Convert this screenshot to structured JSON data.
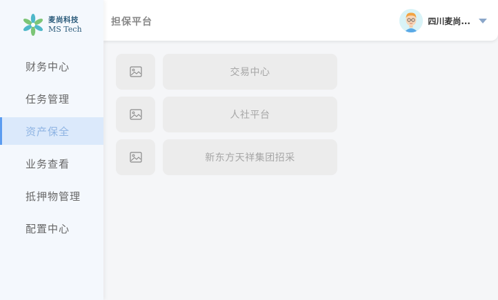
{
  "brand": {
    "name_cn": "麦尚科技",
    "name_en": "MS Tech"
  },
  "header": {
    "title": "担保平台",
    "user_name": "四川麦尚..."
  },
  "menu": {
    "items": [
      {
        "label": "财务中心",
        "active": false
      },
      {
        "label": "任务管理",
        "active": false
      },
      {
        "label": "资产保全",
        "active": true
      },
      {
        "label": "业务查看",
        "active": false
      },
      {
        "label": "抵押物管理",
        "active": false
      },
      {
        "label": "配置中心",
        "active": false
      }
    ]
  },
  "platforms": [
    {
      "label": "交易中心",
      "icon": "image-placeholder-icon"
    },
    {
      "label": "人社平台",
      "icon": "image-placeholder-icon"
    },
    {
      "label": "新东方天祥集团招采",
      "icon": "image-placeholder-icon"
    }
  ],
  "colors": {
    "accent": "#5b9cf0",
    "active_text": "#8fb4e3",
    "active_bg": "#dbe9fb",
    "tile_bg": "#ececec"
  }
}
